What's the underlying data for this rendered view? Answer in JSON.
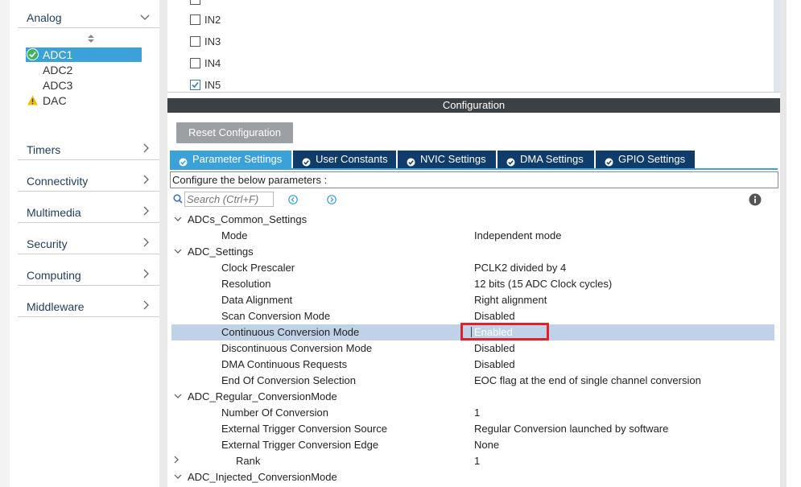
{
  "sidebar": {
    "analog": {
      "label": "Analog"
    },
    "peripherals": [
      {
        "label": "ADC1",
        "status": "ok",
        "selected": true
      },
      {
        "label": "ADC2",
        "status": "none",
        "selected": false
      },
      {
        "label": "ADC3",
        "status": "none",
        "selected": false
      },
      {
        "label": "DAC",
        "status": "warning",
        "selected": false
      }
    ],
    "categories": [
      {
        "label": "Timers"
      },
      {
        "label": "Connectivity"
      },
      {
        "label": "Multimedia"
      },
      {
        "label": "Security"
      },
      {
        "label": "Computing"
      },
      {
        "label": "Middleware"
      }
    ]
  },
  "channels": [
    {
      "label": "IN2",
      "checked": false
    },
    {
      "label": "IN3",
      "checked": false
    },
    {
      "label": "IN4",
      "checked": false
    },
    {
      "label": "IN5",
      "checked": true
    }
  ],
  "configuration": {
    "title": "Configuration",
    "reset_label": "Reset Configuration",
    "tabs": [
      {
        "label": "Parameter Settings",
        "active": true
      },
      {
        "label": "User Constants",
        "active": false
      },
      {
        "label": "NVIC Settings",
        "active": false
      },
      {
        "label": "DMA Settings",
        "active": false
      },
      {
        "label": "GPIO Settings",
        "active": false
      }
    ],
    "hint": "Configure the below parameters :",
    "search_placeholder": "Search (Ctrl+F)",
    "params": [
      {
        "name": "ADCs_Common_Settings",
        "value": "",
        "group": true,
        "expanded": true
      },
      {
        "name": "Mode",
        "value": "Independent mode"
      },
      {
        "name": "ADC_Settings",
        "value": "",
        "group": true,
        "expanded": true
      },
      {
        "name": "Clock Prescaler",
        "value": "PCLK2 divided by 4"
      },
      {
        "name": "Resolution",
        "value": "12 bits (15 ADC Clock cycles)"
      },
      {
        "name": "Data Alignment",
        "value": "Right alignment"
      },
      {
        "name": "Scan Conversion Mode",
        "value": "Disabled"
      },
      {
        "name": "Continuous Conversion Mode",
        "value": "Enabled",
        "highlighted": true
      },
      {
        "name": "Discontinuous Conversion Mode",
        "value": "Disabled"
      },
      {
        "name": "DMA Continuous Requests",
        "value": "Disabled"
      },
      {
        "name": "End Of Conversion Selection",
        "value": "EOC flag at the end of single channel conversion"
      },
      {
        "name": "ADC_Regular_ConversionMode",
        "value": "",
        "group": true,
        "expanded": true
      },
      {
        "name": "Number Of Conversion",
        "value": "1"
      },
      {
        "name": "External Trigger Conversion Source",
        "value": "Regular Conversion launched by software"
      },
      {
        "name": "External Trigger Conversion Edge",
        "value": "None"
      },
      {
        "name": "Rank",
        "value": "1",
        "subgroup": true,
        "expanded": false
      },
      {
        "name": "ADC_Injected_ConversionMode",
        "value": "",
        "group": true,
        "expanded": true
      }
    ]
  },
  "colors": {
    "accent": "#3aa2d8",
    "tab_dark": "#0f3c6a",
    "highlight_row": "#bfd2e8",
    "annotation_red": "#e3202a",
    "ok_green": "#3db35a",
    "warning_yellow": "#f0c000"
  }
}
